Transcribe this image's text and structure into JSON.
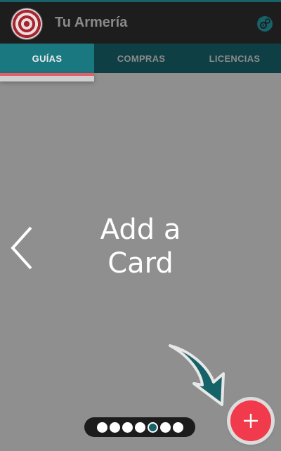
{
  "app": {
    "title": "Tu Armería",
    "logo_icon": "target-icon",
    "settings_icon": "settings-icon"
  },
  "tabs": [
    {
      "label": "GUÍAS",
      "active": true
    },
    {
      "label": "COMPRAS",
      "active": false
    },
    {
      "label": "LICENCIAS",
      "active": false
    }
  ],
  "main": {
    "card_text": "Add a Card",
    "prev_icon": "chevron-left-icon",
    "hint_icon": "curved-arrow-icon"
  },
  "pager": {
    "total": 7,
    "active_index": 4
  },
  "fab": {
    "icon": "plus-icon"
  },
  "colors": {
    "accent": "#1a7880",
    "tab_bar": "#0e3f44",
    "app_bar": "#1d1d1d",
    "fab": "#f13a4c",
    "indicator": "#e35d6a",
    "background": "#8f8f8f"
  }
}
